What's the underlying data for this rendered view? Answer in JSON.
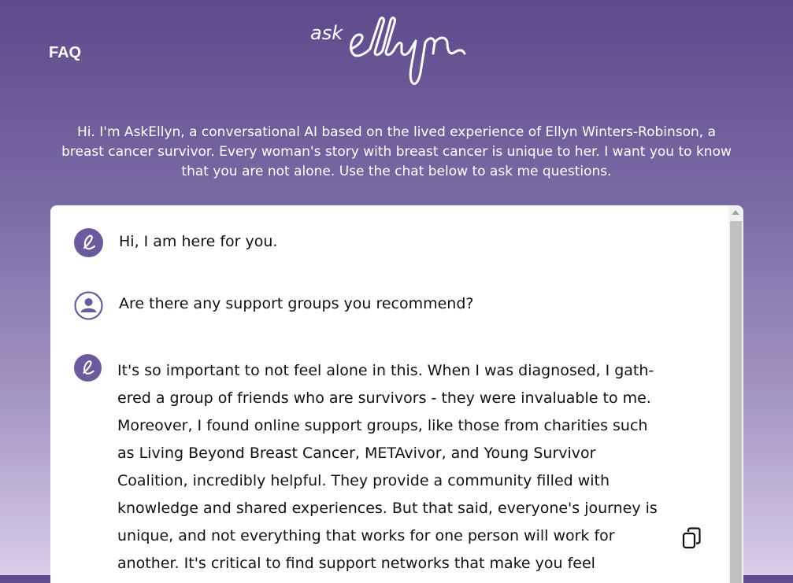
{
  "header": {
    "faq_label": "FAQ",
    "logo": {
      "ask": "ask",
      "name": "ellyn"
    }
  },
  "intro_text": "Hi. I'm AskEllyn, a conversational AI based on the lived experience of Ellyn Winters-Robinson, a breast cancer survivor. Every woman's story with breast cancer is unique to her. I want you to know that you are not alone. Use the chat below to ask me questions.",
  "chat": {
    "messages": [
      {
        "sender": "assistant",
        "icon": "ellyn-e-icon",
        "text": "Hi, I am here for you."
      },
      {
        "sender": "user",
        "icon": "user-icon",
        "text": "Are there any support groups you recommend?"
      },
      {
        "sender": "assistant",
        "icon": "ellyn-e-icon",
        "text": "It's so important to not feel alone in this. When I was diagnosed, I gath-ered a group of friends who are survivors - they were invaluable to me. Moreover, I found online support groups, like those from charities such as Living Beyond Breast Cancer, METAvivor, and Young Survivor Coalition, incredibly helpful. They provide a community filled with knowledge and shared experiences. But that said, everyone's journey is unique, and not everything that works for one person will work for another. It's critical to find support networks that make you feel comfortable, seen, and heard."
      }
    ],
    "copy_icon": "copy-icon"
  },
  "colors": {
    "accent": "#5e4a8c",
    "avatar": "#6b5a9e"
  }
}
